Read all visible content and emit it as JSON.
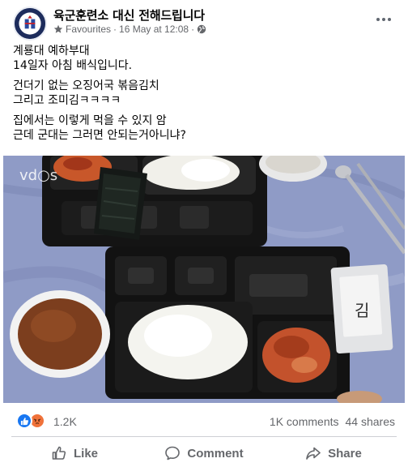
{
  "post": {
    "page_name": "육군훈련소 대신 전해드립니다",
    "audience_label": "Favourites",
    "separator": "·",
    "date": "16 May at 12:08",
    "separator2": "·",
    "text_lines": [
      [
        "계룡대 예하부대",
        "14일자 아침 배식입니다."
      ],
      [
        "건더기 없는 오징어국 볶음김치",
        "그리고 조미김ㅋㅋㅋㅋ"
      ],
      [
        "집에서는 이렇게 먹을 수 있지 암",
        "근데 군대는 그러면 안되는거아니냐?"
      ]
    ]
  },
  "photo": {
    "watermark": "vd○s",
    "seaweed_packet_label": "김"
  },
  "reactions": {
    "count": "1.2K",
    "comments": "1K comments",
    "shares": "44 shares"
  },
  "actions": {
    "like": "Like",
    "comment": "Comment",
    "share": "Share"
  },
  "colors": {
    "facebook_blue": "#1877f2",
    "secondary_text": "#65676b",
    "angry": "#f0723a"
  },
  "icons": {
    "audience": "star-icon",
    "privacy": "globe-icon",
    "more": "ellipsis-icon",
    "like_reaction": "thumbs-up-icon",
    "angry_reaction": "angry-face-icon",
    "like_action": "thumbs-up-outline-icon",
    "comment_action": "speech-bubble-icon",
    "share_action": "share-arrow-icon"
  }
}
